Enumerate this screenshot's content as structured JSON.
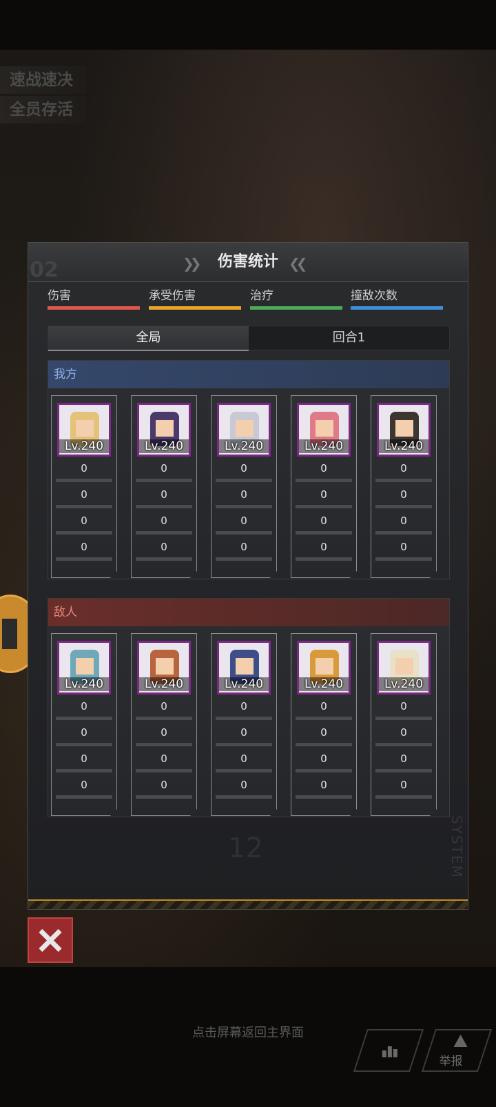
{
  "objectives": [
    "速战速决",
    "全员存活"
  ],
  "panel": {
    "title": "伤害统计",
    "corner_number": "02",
    "legend": [
      {
        "label": "伤害",
        "color": "#e0574c"
      },
      {
        "label": "承受伤害",
        "color": "#e8a52a"
      },
      {
        "label": "治疗",
        "color": "#4caa5a"
      },
      {
        "label": "撞敌次数",
        "color": "#3f8ede"
      }
    ],
    "tabs": {
      "global": "全局",
      "round1": "回合1"
    },
    "ally": {
      "label": "我方",
      "units": [
        {
          "level": "Lv.240",
          "stats": [
            "0",
            "0",
            "0",
            "0"
          ]
        },
        {
          "level": "Lv.240",
          "stats": [
            "0",
            "0",
            "0",
            "0"
          ]
        },
        {
          "level": "Lv.240",
          "stats": [
            "0",
            "0",
            "0",
            "0"
          ]
        },
        {
          "level": "Lv.240",
          "stats": [
            "0",
            "0",
            "0",
            "0"
          ]
        },
        {
          "level": "Lv.240",
          "stats": [
            "0",
            "0",
            "0",
            "0"
          ]
        }
      ]
    },
    "enemy": {
      "label": "敌人",
      "units": [
        {
          "level": "Lv.240",
          "stats": [
            "0",
            "0",
            "0",
            "0"
          ]
        },
        {
          "level": "Lv.240",
          "stats": [
            "0",
            "0",
            "0",
            "0"
          ]
        },
        {
          "level": "Lv.240",
          "stats": [
            "0",
            "0",
            "0",
            "0"
          ]
        },
        {
          "level": "Lv.240",
          "stats": [
            "0",
            "0",
            "0",
            "0"
          ]
        },
        {
          "level": "Lv.240",
          "stats": [
            "0",
            "0",
            "0",
            "0"
          ]
        }
      ]
    },
    "deco_number": "12",
    "deco_system": "SYSTEM"
  },
  "footer": {
    "hint": "点击屏幕返回主界面",
    "report_label": "举报"
  }
}
